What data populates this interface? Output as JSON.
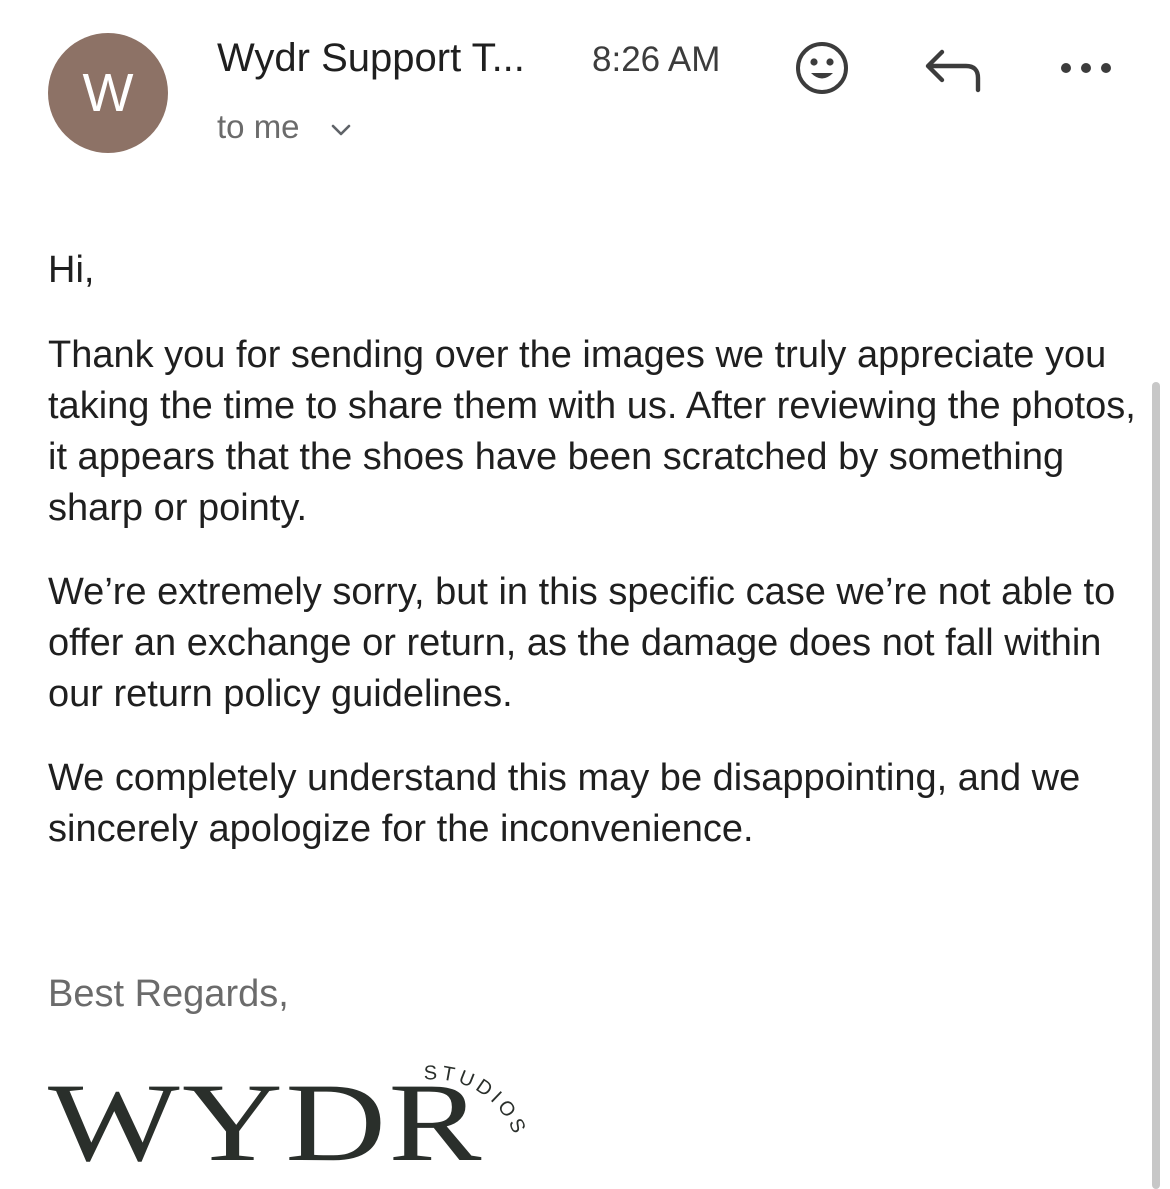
{
  "email": {
    "avatar_letter": "W",
    "sender": "Wydr Support T...",
    "time": "8:26 AM",
    "recipient": "to me",
    "icons": {
      "emoji": "smiley-face-icon",
      "reply": "reply-arrow-icon",
      "more": "more-horizontal-icon",
      "expand": "chevron-down-icon"
    },
    "greeting": "Hi,",
    "paragraphs": [
      "Thank you for sending over the images we truly appreciate you taking the time to share them with us. After reviewing the photos, it appears that the shoes have been scratched by something sharp or pointy.",
      "We’re extremely sorry, but in this specific case we’re not able to offer an exchange or return, as the damage does not fall within our return policy guidelines.",
      "We completely understand this may be disappointing, and we sincerely apologize for the inconvenience."
    ],
    "signoff": "Best Regards,",
    "logo": {
      "wordmark": "WYDR",
      "subtext": "STUDIOS"
    }
  },
  "colors": {
    "avatar_bg": "#8d7266",
    "text": "#1f1f1f",
    "secondary_text": "#6b6b6b",
    "logo": "#2a2f2b"
  }
}
